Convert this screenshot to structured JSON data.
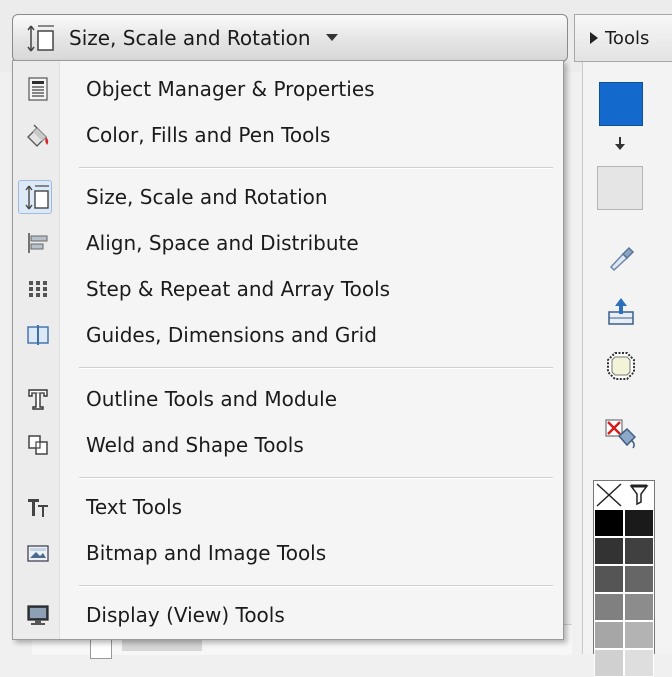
{
  "header": {
    "dropdown_label": "Size, Scale and Rotation",
    "tools_tab_label": "Tools"
  },
  "menu": {
    "items": [
      {
        "label": "Object Manager & Properties",
        "icon": "object-manager-icon"
      },
      {
        "label": "Color, Fills and Pen Tools",
        "icon": "paint-bucket-icon"
      },
      {
        "label": "Size, Scale and Rotation",
        "icon": "size-scale-icon",
        "selected": true
      },
      {
        "label": "Align, Space and Distribute",
        "icon": "align-icon"
      },
      {
        "label": "Step & Repeat and Array Tools",
        "icon": "array-grid-icon"
      },
      {
        "label": "Guides, Dimensions and Grid",
        "icon": "guides-icon"
      },
      {
        "label": "Outline Tools and Module",
        "icon": "outline-text-icon"
      },
      {
        "label": "Weld and Shape Tools",
        "icon": "weld-shapes-icon"
      },
      {
        "label": "Text Tools",
        "icon": "text-tool-icon"
      },
      {
        "label": "Bitmap and Image Tools",
        "icon": "bitmap-icon"
      },
      {
        "label": "Display (View) Tools",
        "icon": "display-monitor-icon"
      }
    ]
  },
  "toolbar": {
    "fill_color": "#1469cc",
    "stroke_color": "#e5e5e5",
    "icons": [
      "swap-arrow-icon",
      "eyedropper-icon",
      "apply-icon",
      "shape-node-icon",
      "remove-fill-icon"
    ]
  },
  "palette": {
    "colors": [
      "#000000",
      "#1a1a1a",
      "#333333",
      "#404040",
      "#555555",
      "#666666",
      "#808080",
      "#8c8c8c",
      "#a6a6a6",
      "#b3b3b3",
      "#d0d0d0",
      "#dedede"
    ]
  },
  "colors": {
    "accent": "#1469cc",
    "menu_background": "#f5f5f5"
  }
}
